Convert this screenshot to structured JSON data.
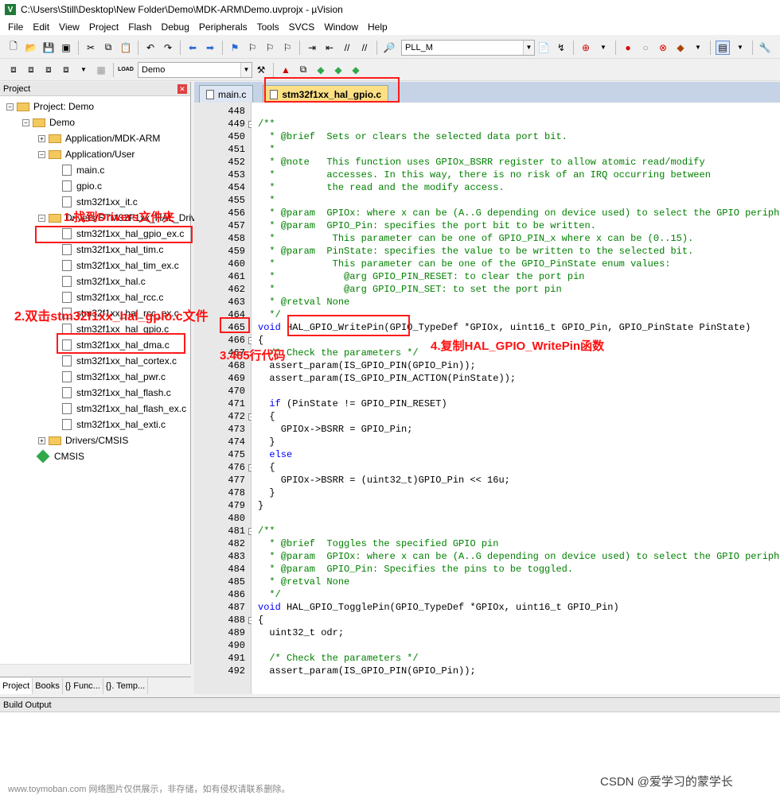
{
  "window": {
    "title": "C:\\Users\\Still\\Desktop\\New Folder\\Demo\\MDK-ARM\\Demo.uvprojx - µVision"
  },
  "menu": [
    "File",
    "Edit",
    "View",
    "Project",
    "Flash",
    "Debug",
    "Peripherals",
    "Tools",
    "SVCS",
    "Window",
    "Help"
  ],
  "toolbar": {
    "function_combo": "PLL_M",
    "target_combo": "Demo"
  },
  "project_panel": {
    "title": "Project",
    "tree": [
      {
        "label": "Project: Demo",
        "kind": "root"
      },
      {
        "label": "Demo",
        "kind": "target"
      },
      {
        "label": "Application/MDK-ARM",
        "kind": "folder-closed"
      },
      {
        "label": "Application/User",
        "kind": "folder-open"
      },
      {
        "label": "main.c",
        "kind": "file"
      },
      {
        "label": "gpio.c",
        "kind": "file"
      },
      {
        "label": "stm32f1xx_it.c",
        "kind": "file"
      },
      {
        "label": "Drivers/STM32F1xx_HAL_Driv",
        "kind": "folder-open"
      },
      {
        "label": "stm32f1xx_hal_gpio_ex.c",
        "kind": "file"
      },
      {
        "label": "stm32f1xx_hal_tim.c",
        "kind": "file"
      },
      {
        "label": "stm32f1xx_hal_tim_ex.c",
        "kind": "file"
      },
      {
        "label": "stm32f1xx_hal.c",
        "kind": "file"
      },
      {
        "label": "stm32f1xx_hal_rcc.c",
        "kind": "file"
      },
      {
        "label": "stm32f1xx_hal_rcc_ex.c",
        "kind": "file"
      },
      {
        "label": "stm32f1xx_hal_gpio.c",
        "kind": "file"
      },
      {
        "label": "stm32f1xx_hal_dma.c",
        "kind": "file"
      },
      {
        "label": "stm32f1xx_hal_cortex.c",
        "kind": "file"
      },
      {
        "label": "stm32f1xx_hal_pwr.c",
        "kind": "file"
      },
      {
        "label": "stm32f1xx_hal_flash.c",
        "kind": "file"
      },
      {
        "label": "stm32f1xx_hal_flash_ex.c",
        "kind": "file"
      },
      {
        "label": "stm32f1xx_hal_exti.c",
        "kind": "file"
      },
      {
        "label": "Drivers/CMSIS",
        "kind": "folder-closed"
      },
      {
        "label": "CMSIS",
        "kind": "gem"
      }
    ],
    "bottom_tabs": [
      "Project",
      "Books",
      "{} Func...",
      "{}. Temp..."
    ]
  },
  "editor": {
    "tabs": [
      {
        "label": "main.c",
        "active": false
      },
      {
        "label": "stm32f1xx_hal_gpio.c",
        "active": true
      }
    ],
    "lines": [
      {
        "n": "448",
        "t": ""
      },
      {
        "n": "449",
        "t": "/**",
        "c": "cm",
        "fold": true
      },
      {
        "n": "450",
        "t": "  * @brief  Sets or clears the selected data port bit.",
        "c": "cm"
      },
      {
        "n": "451",
        "t": "  *",
        "c": "cm"
      },
      {
        "n": "452",
        "t": "  * @note   This function uses GPIOx_BSRR register to allow atomic read/modify",
        "c": "cm"
      },
      {
        "n": "453",
        "t": "  *         accesses. In this way, there is no risk of an IRQ occurring between",
        "c": "cm"
      },
      {
        "n": "454",
        "t": "  *         the read and the modify access.",
        "c": "cm"
      },
      {
        "n": "455",
        "t": "  *",
        "c": "cm"
      },
      {
        "n": "456",
        "t": "  * @param  GPIOx: where x can be (A..G depending on device used) to select the GPIO peripheral",
        "c": "cm"
      },
      {
        "n": "457",
        "t": "  * @param  GPIO_Pin: specifies the port bit to be written.",
        "c": "cm"
      },
      {
        "n": "458",
        "t": "  *          This parameter can be one of GPIO_PIN_x where x can be (0..15).",
        "c": "cm"
      },
      {
        "n": "459",
        "t": "  * @param  PinState: specifies the value to be written to the selected bit.",
        "c": "cm"
      },
      {
        "n": "460",
        "t": "  *          This parameter can be one of the GPIO_PinState enum values:",
        "c": "cm"
      },
      {
        "n": "461",
        "t": "  *            @arg GPIO_PIN_RESET: to clear the port pin",
        "c": "cm"
      },
      {
        "n": "462",
        "t": "  *            @arg GPIO_PIN_SET: to set the port pin",
        "c": "cm"
      },
      {
        "n": "463",
        "t": "  * @retval None",
        "c": "cm"
      },
      {
        "n": "464",
        "t": "  */",
        "c": "cm"
      },
      {
        "n": "465",
        "t": "void HAL_GPIO_WritePin(GPIO_TypeDef *GPIOx, uint16_t GPIO_Pin, GPIO_PinState PinState)",
        "kwpre": "void"
      },
      {
        "n": "466",
        "t": "{",
        "fold": true
      },
      {
        "n": "467",
        "t": "  /* Check the parameters */",
        "c": "cm"
      },
      {
        "n": "468",
        "t": "  assert_param(IS_GPIO_PIN(GPIO_Pin));"
      },
      {
        "n": "469",
        "t": "  assert_param(IS_GPIO_PIN_ACTION(PinState));"
      },
      {
        "n": "470",
        "t": ""
      },
      {
        "n": "471",
        "t": "  if (PinState != GPIO_PIN_RESET)",
        "kwpre": "  if"
      },
      {
        "n": "472",
        "t": "  {",
        "fold": true
      },
      {
        "n": "473",
        "t": "    GPIOx->BSRR = GPIO_Pin;"
      },
      {
        "n": "474",
        "t": "  }"
      },
      {
        "n": "475",
        "t": "  else",
        "c": "kw"
      },
      {
        "n": "476",
        "t": "  {",
        "fold": true
      },
      {
        "n": "477",
        "t": "    GPIOx->BSRR = (uint32_t)GPIO_Pin << 16u;"
      },
      {
        "n": "478",
        "t": "  }"
      },
      {
        "n": "479",
        "t": "}"
      },
      {
        "n": "480",
        "t": ""
      },
      {
        "n": "481",
        "t": "/**",
        "c": "cm",
        "fold": true
      },
      {
        "n": "482",
        "t": "  * @brief  Toggles the specified GPIO pin",
        "c": "cm"
      },
      {
        "n": "483",
        "t": "  * @param  GPIOx: where x can be (A..G depending on device used) to select the GPIO peripheral",
        "c": "cm"
      },
      {
        "n": "484",
        "t": "  * @param  GPIO_Pin: Specifies the pins to be toggled.",
        "c": "cm"
      },
      {
        "n": "485",
        "t": "  * @retval None",
        "c": "cm"
      },
      {
        "n": "486",
        "t": "  */",
        "c": "cm"
      },
      {
        "n": "487",
        "t": "void HAL_GPIO_TogglePin(GPIO_TypeDef *GPIOx, uint16_t GPIO_Pin)",
        "kwpre": "void"
      },
      {
        "n": "488",
        "t": "{",
        "fold": true
      },
      {
        "n": "489",
        "t": "  uint32_t odr;"
      },
      {
        "n": "490",
        "t": ""
      },
      {
        "n": "491",
        "t": "  /* Check the parameters */",
        "c": "cm"
      },
      {
        "n": "492",
        "t": "  assert_param(IS_GPIO_PIN(GPIO_Pin));"
      }
    ]
  },
  "build_output": {
    "title": "Build Output"
  },
  "annotations": {
    "step1": "1.找到Drivers文件夹",
    "step2": "2.双击stm32f1xx_hal_gpio.c文件",
    "step3": "3.465行代码",
    "step4": "4.复制HAL_GPIO_WritePin函数"
  },
  "watermark": "www.toymoban.com 网络图片仅供展示，非存储，如有侵权请联系删除。",
  "credit": "CSDN @爱学习的蒙学长",
  "colors": {
    "annotation_red": "#ff1a1a",
    "comment_green": "#008000",
    "keyword_blue": "#0000ff",
    "active_tab": "#fddf84"
  }
}
